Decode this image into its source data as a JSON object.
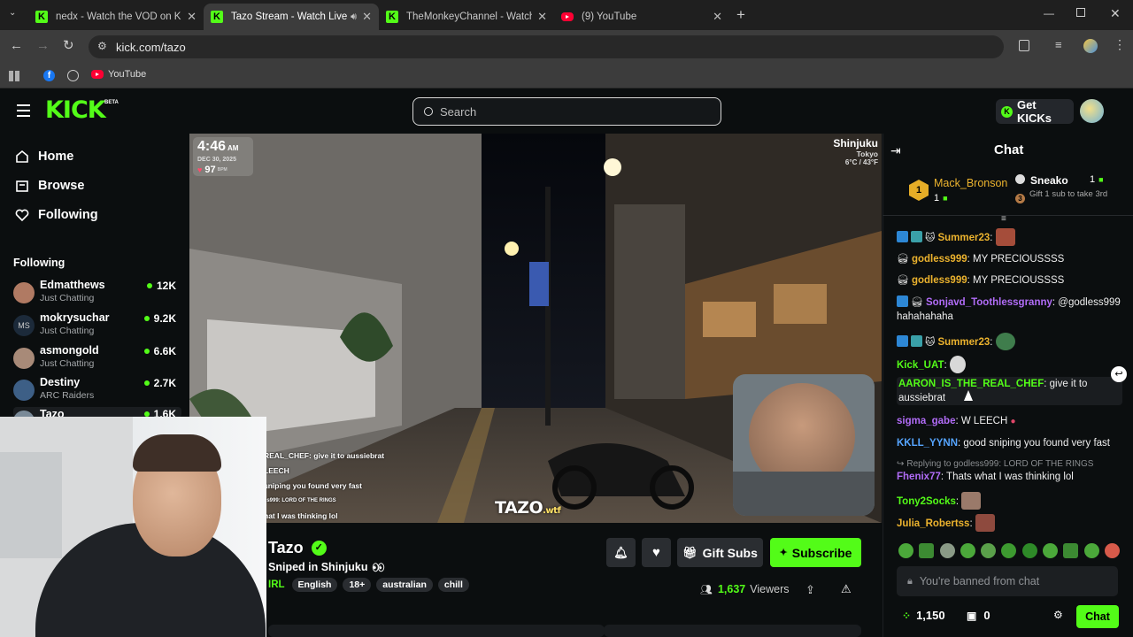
{
  "browser": {
    "tabs": [
      {
        "label": "nedx - Watch the VOD on Kick",
        "favicon": "kick-icon"
      },
      {
        "label": "Tazo Stream - Watch Live on Kick",
        "favicon": "kick-icon"
      },
      {
        "label": "TheMonkeyChannel - Watch the VOD on Kick",
        "favicon": "kick-icon"
      },
      {
        "label": "(9) YouTube",
        "favicon": "youtube-icon"
      }
    ],
    "url": "kick.com/tazo",
    "bookmarks": [
      {
        "label": "YouTube"
      }
    ]
  },
  "kick": {
    "logo": "KICK",
    "logo_badge": "BETA",
    "search_placeholder": "Search",
    "get_kicks": "Get KICKs",
    "accent": "#53fc18"
  },
  "sidebar": {
    "nav": [
      {
        "label": "Home",
        "icon": "home-icon"
      },
      {
        "label": "Browse",
        "icon": "browse-icon"
      },
      {
        "label": "Following",
        "icon": "heart-icon"
      }
    ],
    "following_heading": "Following",
    "channels": [
      {
        "name": "Edmatthews",
        "category": "Just Chatting",
        "viewers": "12K"
      },
      {
        "name": "mokrysuchar",
        "category": "Just Chatting",
        "viewers": "9.2K"
      },
      {
        "name": "asmongold",
        "category": "Just Chatting",
        "viewers": "6.6K"
      },
      {
        "name": "Destiny",
        "category": "ARC Raiders",
        "viewers": "2.7K"
      },
      {
        "name": "Tazo",
        "category": "",
        "viewers": "1.6K"
      }
    ]
  },
  "video": {
    "time": "4:46",
    "ampm": "AM",
    "date": "DEC 30, 2025",
    "heart_rate": "97",
    "bpm": "BPM",
    "location": "Shinjuku",
    "city": "Tokyo",
    "temp": "6°C / 43°F",
    "watermark": "TAZO",
    "watermark_suffix": ".wtf",
    "overlay_chat": [
      "REAL_CHEF: give it to aussiebrat",
      "LEECH",
      "sniping you found very fast",
      "ss999: LORD OF THE RINGS",
      "hat I was thinking lol"
    ]
  },
  "stream": {
    "channel": "Tazo",
    "title": "Sniped in Shinjuku",
    "category": "IRL",
    "tags": [
      "English",
      "18+",
      "australian",
      "chill"
    ],
    "viewers": "1,637",
    "viewers_label": "Viewers",
    "gift_subs": "Gift Subs",
    "subscribe": "Subscribe"
  },
  "chat": {
    "title": "Chat",
    "leader1": {
      "rank": "1",
      "name": "Mack_Bronson",
      "count": "1"
    },
    "leader2": {
      "name": "Sneako",
      "count": "1",
      "note": "Gift 1 sub to take 3rd",
      "rank": "3"
    },
    "messages": [
      {
        "user": "Summer23",
        "text": "",
        "color": "#ecb32e"
      },
      {
        "user": "godless999",
        "text": "MY PRECIOUSSSS",
        "color": "#ecb32e"
      },
      {
        "user": "godless999",
        "text": "MY PRECIOUSSSS",
        "color": "#ecb32e"
      },
      {
        "user": "Sonjavd_Toothlessgranny",
        "text": "@godless999 hahahahaha",
        "color": "#b16cf7"
      },
      {
        "user": "Summer23",
        "text": "",
        "color": "#ecb32e"
      },
      {
        "user": "Kick_UAT",
        "text": "",
        "color": "#53fc18"
      },
      {
        "user": "AARON_IS_THE_REAL_CHEF",
        "text": "give it to aussiebrat",
        "color": "#53fc18"
      },
      {
        "user": "sigma_gabe",
        "text": "W LEECH",
        "color": "#b16cf7"
      },
      {
        "user": "KKLL_YYNN",
        "text": "good sniping you found very fast",
        "color": "#56a5ff"
      },
      {
        "user": "Fhenix77",
        "text": "Thats what I was thinking lol",
        "color": "#b16cf7",
        "reply": "Replying to godless999: LORD OF THE RINGS"
      },
      {
        "user": "Tony2Socks",
        "text": "",
        "color": "#53fc18"
      },
      {
        "user": "Julia_Robertss",
        "text": "",
        "color": "#ecb32e"
      }
    ],
    "banned_placeholder": "You're banned from chat",
    "points": "1,150",
    "drops": "0",
    "chat_button": "Chat"
  }
}
